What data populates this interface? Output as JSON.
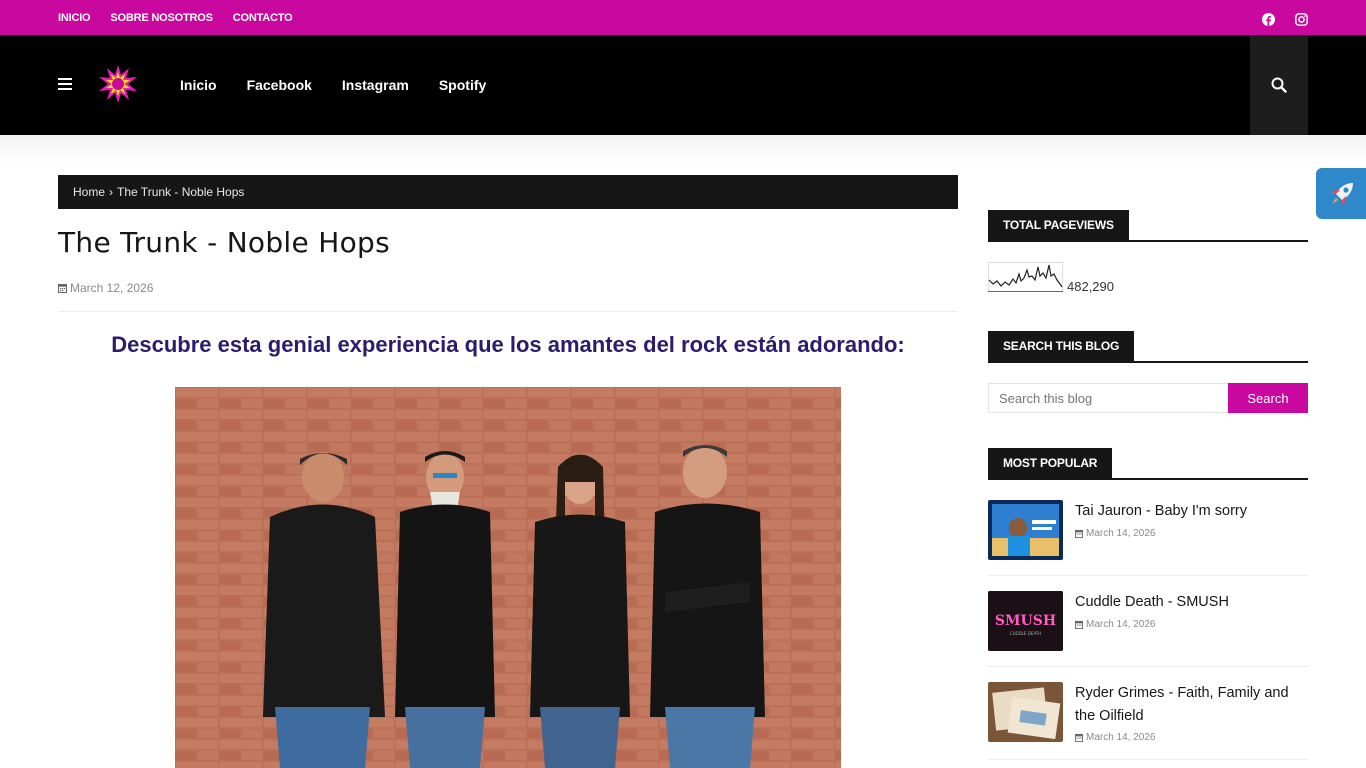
{
  "topbar": {
    "links": [
      "INICIO",
      "SOBRE NOSOTROS",
      "CONTACTO"
    ],
    "social": [
      "facebook-icon",
      "instagram-icon"
    ]
  },
  "header": {
    "nav": [
      "Inicio",
      "Facebook",
      "Instagram",
      "Spotify"
    ]
  },
  "breadcrumb": {
    "home": "Home",
    "separator": "›",
    "current": "The Trunk - Noble Hops"
  },
  "post": {
    "title": "The Trunk - Noble Hops",
    "date": "March 12, 2026",
    "subheading": "Descubre esta genial experiencia que los amantes del rock están adorando:"
  },
  "sidebar": {
    "pageviews": {
      "title": "TOTAL PAGEVIEWS",
      "count": "482,290"
    },
    "search": {
      "title": "SEARCH THIS BLOG",
      "placeholder": "Search this blog",
      "button": "Search"
    },
    "popular": {
      "title": "MOST POPULAR",
      "items": [
        {
          "title": "Tai Jauron - Baby I'm sorry",
          "date": "March 14, 2026"
        },
        {
          "title": "Cuddle Death - SMUSH",
          "date": "March 14, 2026",
          "thumb_text": "SMUSH",
          "thumb_subtext": "CUDDLE DEATH"
        },
        {
          "title": "Ryder Grimes - Faith, Family and the Oilfield",
          "date": "March 14, 2026"
        }
      ]
    }
  },
  "colors": {
    "accent": "#c9089f",
    "dark": "#000000",
    "subheading": "#2b1c6e"
  }
}
